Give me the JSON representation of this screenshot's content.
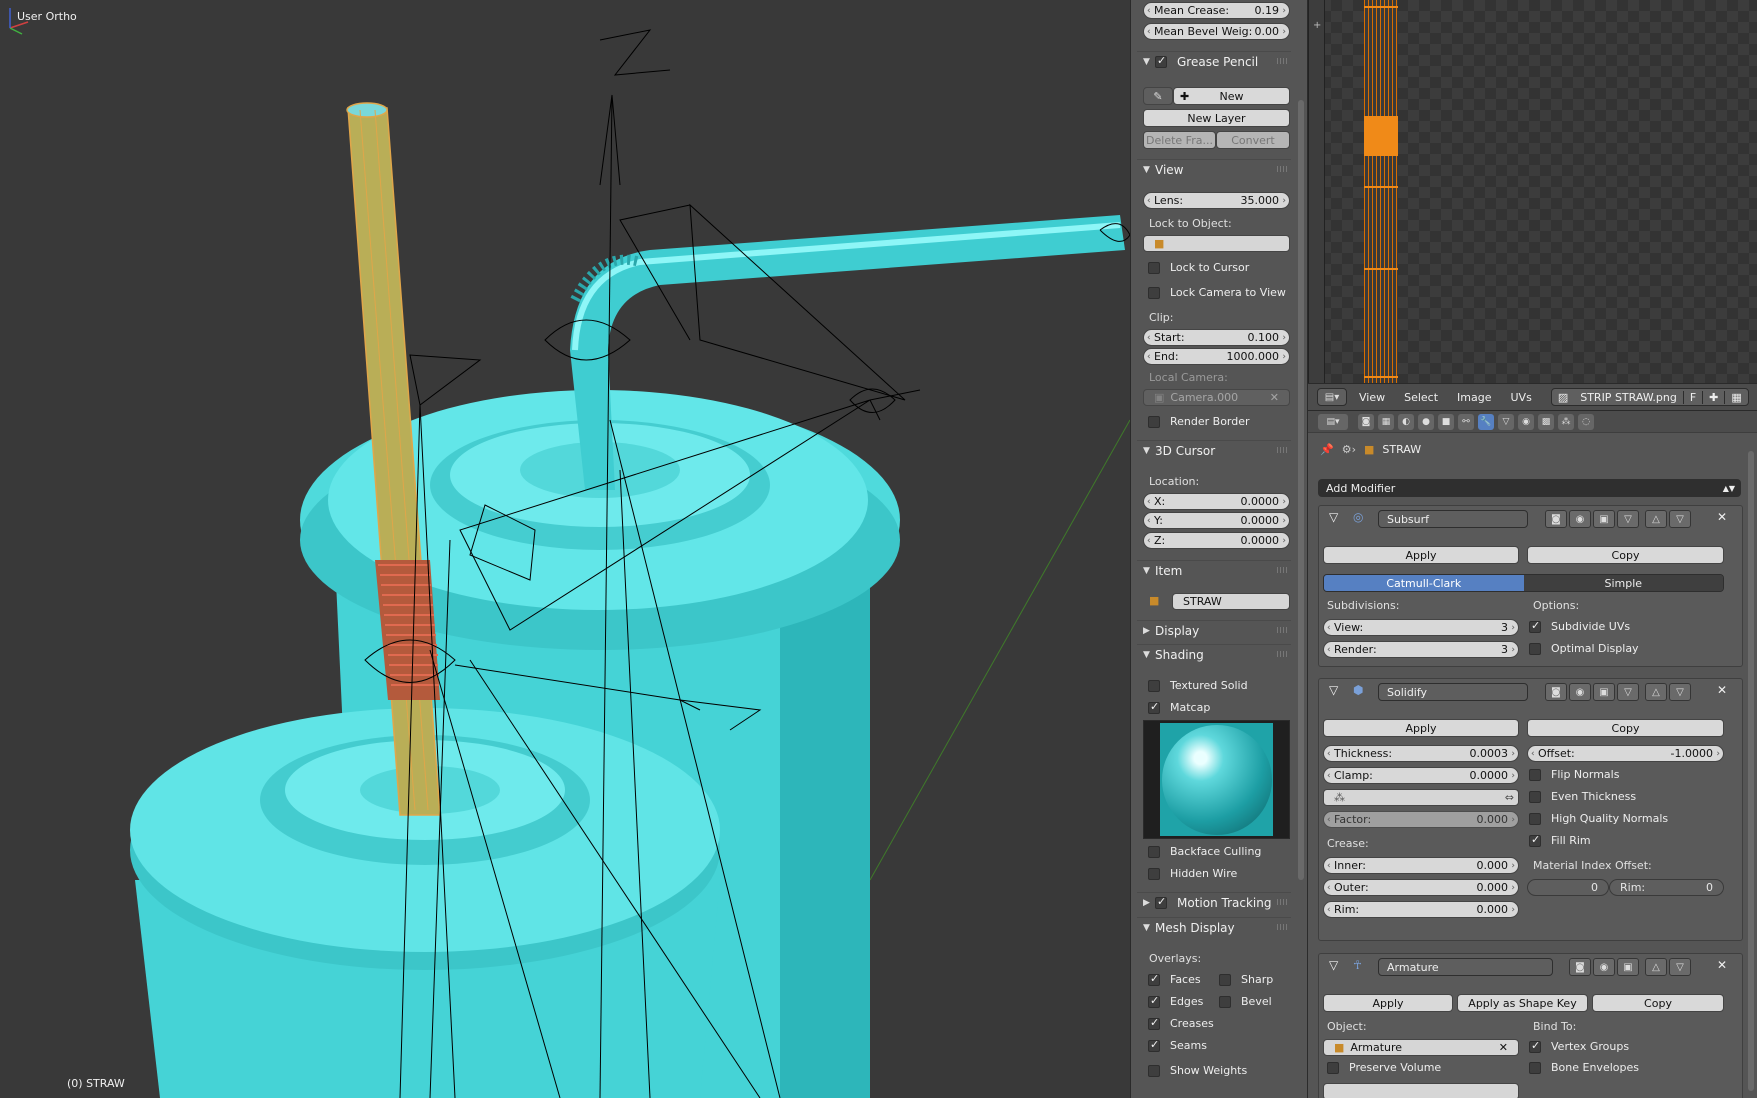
{
  "viewport": {
    "title": "User Ortho",
    "object_label": "(0) STRAW",
    "gizmo_axes": [
      "x",
      "y",
      "z"
    ]
  },
  "npanel": {
    "mean_crease": {
      "label": "Mean Crease:",
      "value": "0.19"
    },
    "mean_bevel": {
      "label": "Mean Bevel Weig:",
      "value": "0.00"
    },
    "grease_pencil": {
      "title": "Grease Pencil",
      "new_label": "New",
      "new_layer_label": "New Layer",
      "delete_frame_label": "Delete Fra...",
      "convert_label": "Convert"
    },
    "view": {
      "title": "View",
      "lens": {
        "label": "Lens:",
        "value": "35.000"
      },
      "lock_to_object_label": "Lock to Object:",
      "lock_to_cursor": "Lock to Cursor",
      "lock_camera_to_view": "Lock Camera to View",
      "clip_label": "Clip:",
      "clip_start": {
        "label": "Start:",
        "value": "0.100"
      },
      "clip_end": {
        "label": "End:",
        "value": "1000.000"
      },
      "local_camera_label": "Local Camera:",
      "local_camera_value": "Camera.000",
      "render_border": "Render Border"
    },
    "cursor": {
      "title": "3D Cursor",
      "location_label": "Location:",
      "x": {
        "label": "X:",
        "value": "0.0000"
      },
      "y": {
        "label": "Y:",
        "value": "0.0000"
      },
      "z": {
        "label": "Z:",
        "value": "0.0000"
      }
    },
    "item": {
      "title": "Item",
      "name": "STRAW"
    },
    "display": {
      "title": "Display"
    },
    "shading": {
      "title": "Shading",
      "textured_solid": "Textured Solid",
      "matcap": "Matcap",
      "backface_culling": "Backface Culling",
      "hidden_wire": "Hidden Wire"
    },
    "motion_tracking": {
      "title": "Motion Tracking"
    },
    "mesh_display": {
      "title": "Mesh Display",
      "overlays_label": "Overlays:",
      "faces": "Faces",
      "sharp": "Sharp",
      "edges": "Edges",
      "bevel": "Bevel",
      "creases": "Creases",
      "seams": "Seams",
      "show_weights": "Show Weights"
    }
  },
  "uv_header": {
    "menus": [
      "View",
      "Select",
      "Image",
      "UVs"
    ],
    "image_name": "STRIP STRAW.png",
    "fake_user": "F"
  },
  "properties": {
    "object_name": "STRAW",
    "add_modifier_label": "Add Modifier",
    "subsurf": {
      "name": "Subsurf",
      "apply": "Apply",
      "copy": "Copy",
      "catmull": "Catmull-Clark",
      "simple": "Simple",
      "subdivisions_label": "Subdivisions:",
      "options_label": "Options:",
      "view": {
        "label": "View:",
        "value": "3"
      },
      "render": {
        "label": "Render:",
        "value": "3"
      },
      "subdivide_uvs": "Subdivide UVs",
      "optimal_display": "Optimal Display"
    },
    "solidify": {
      "name": "Solidify",
      "apply": "Apply",
      "copy": "Copy",
      "thickness": {
        "label": "Thickness:",
        "value": "0.0003"
      },
      "offset": {
        "label": "Offset:",
        "value": "-1.0000"
      },
      "clamp": {
        "label": "Clamp:",
        "value": "0.0000"
      },
      "flip_normals": "Flip Normals",
      "even_thickness": "Even Thickness",
      "high_quality_normals": "High Quality Normals",
      "fill_rim": "Fill Rim",
      "factor": {
        "label": "Factor:",
        "value": "0.000"
      },
      "crease_label": "Crease:",
      "material_index_label": "Material Index Offset:",
      "inner": {
        "label": "Inner:",
        "value": "0.000"
      },
      "outer": {
        "label": "Outer:",
        "value": "0.000"
      },
      "rim": {
        "label": "Rim:",
        "value": "0.000"
      },
      "mat_offset": "0",
      "mat_rim": {
        "label": "Rim:",
        "value": "0"
      }
    },
    "armature": {
      "name": "Armature",
      "apply": "Apply",
      "apply_shape_key": "Apply as Shape Key",
      "copy": "Copy",
      "object_label": "Object:",
      "object_value": "Armature",
      "bind_to_label": "Bind To:",
      "vertex_groups": "Vertex Groups",
      "preserve_volume": "Preserve Volume",
      "bone_envelopes": "Bone Envelopes"
    }
  },
  "colors": {
    "cup": "#56e1e3",
    "straw_selected": "#e0a64a",
    "accent_blue": "#5680c2",
    "uv_orange": "#f08a18"
  }
}
